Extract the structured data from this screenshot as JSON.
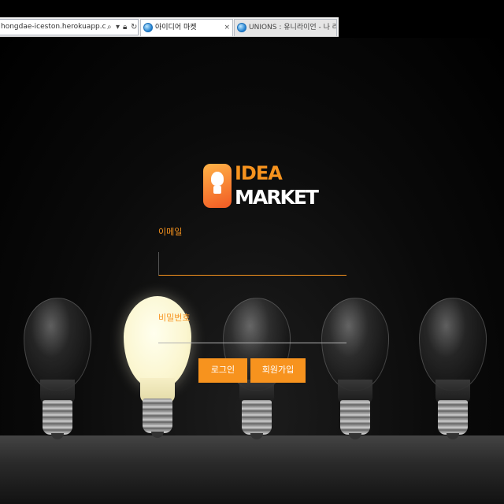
{
  "browser": {
    "address_url": "hongdae-iceston.herokuapp.com/users/sig",
    "tabs": [
      {
        "label": "아이디어 마켓",
        "active": true,
        "close": "×"
      },
      {
        "label": "UNIONS : 유니라이언 - 나 라...",
        "active": false
      }
    ]
  },
  "logo": {
    "line1": "IDEA",
    "line2": "MARKET",
    "accent_color": "#f7931e"
  },
  "form": {
    "email_label": "이메일",
    "email_value": "",
    "password_label": "비밀번호",
    "password_value": ""
  },
  "buttons": {
    "login": "로그인",
    "signup": "회원가입"
  },
  "colors": {
    "accent": "#f7931e",
    "background": "#000000"
  }
}
